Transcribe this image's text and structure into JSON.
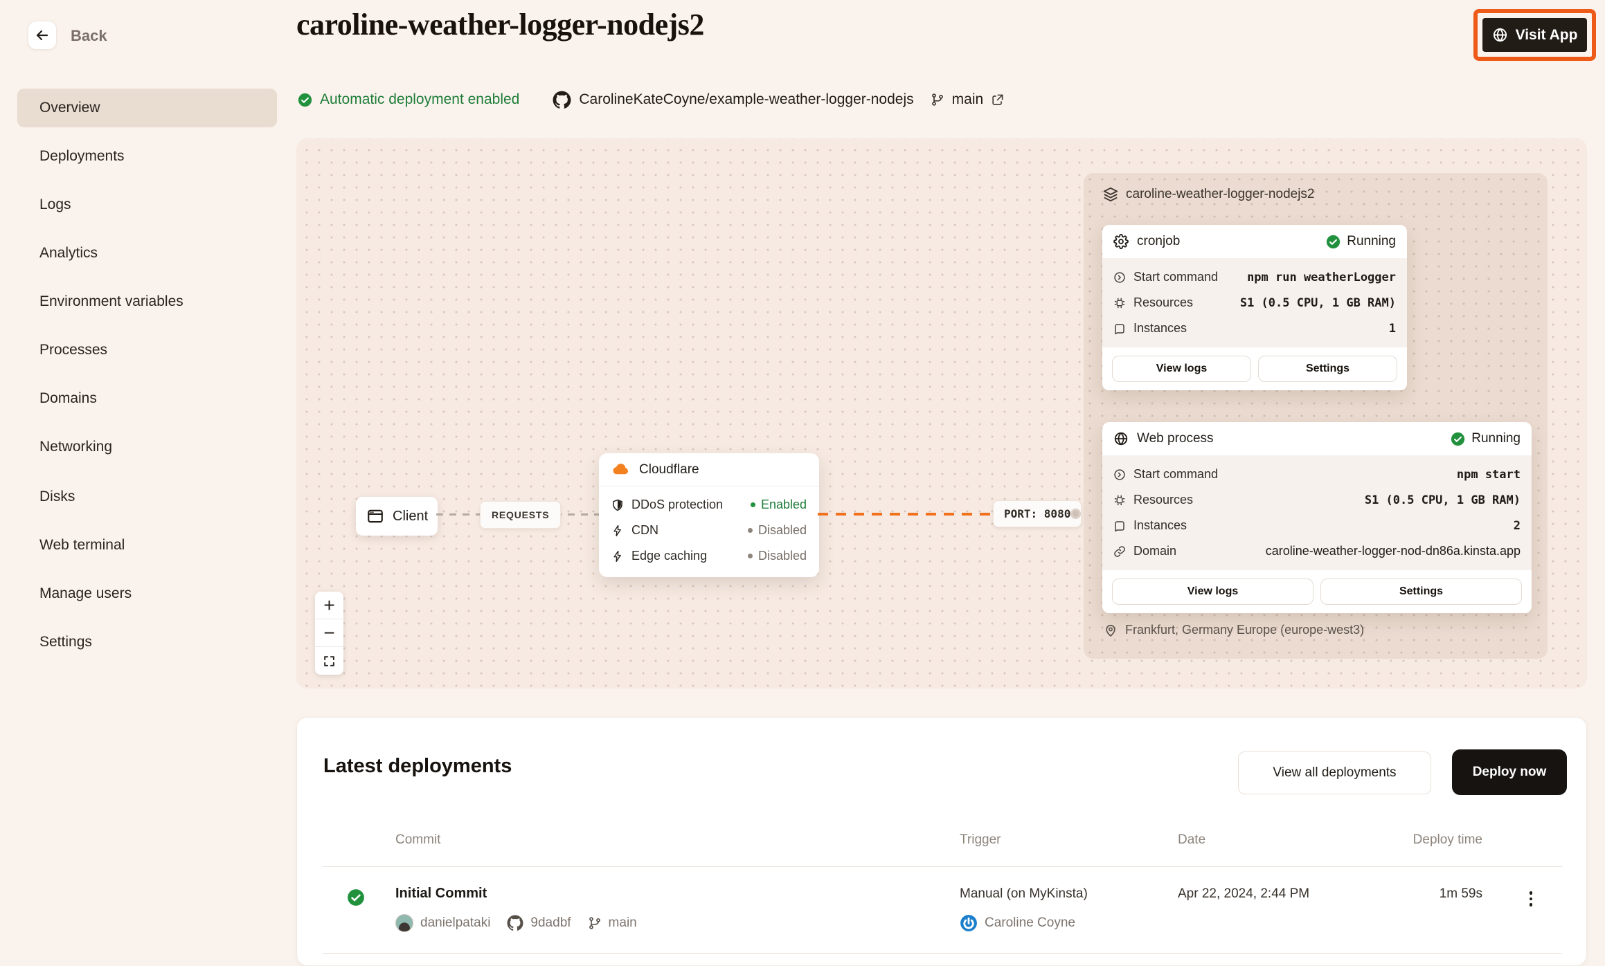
{
  "header": {
    "back_label": "Back",
    "title": "caroline-weather-logger-nodejs2",
    "visit_app_label": "Visit App"
  },
  "sidebar": {
    "items": [
      {
        "label": "Overview",
        "active": true
      },
      {
        "label": "Deployments"
      },
      {
        "label": "Logs"
      },
      {
        "label": "Analytics"
      },
      {
        "label": "Environment variables"
      },
      {
        "label": "Processes"
      },
      {
        "label": "Domains"
      },
      {
        "label": "Networking"
      },
      {
        "label": "Disks"
      },
      {
        "label": "Web terminal"
      },
      {
        "label": "Manage users"
      },
      {
        "label": "Settings"
      }
    ]
  },
  "status_bar": {
    "deployment_status": "Automatic deployment enabled",
    "repo": "CarolineKateCoyne/example-weather-logger-nodejs",
    "branch": "main"
  },
  "diagram": {
    "client_label": "Client",
    "requests_label": "REQUESTS",
    "port_label": "PORT: 8080",
    "cloudflare": {
      "title": "Cloudflare",
      "rows": [
        {
          "icon": "shield-icon",
          "label": "DDoS protection",
          "status": "Enabled"
        },
        {
          "icon": "lightning-icon",
          "label": "CDN",
          "status": "Disabled"
        },
        {
          "icon": "lightning-icon",
          "label": "Edge caching",
          "status": "Disabled"
        }
      ]
    },
    "group": {
      "title": "caroline-weather-logger-nodejs2",
      "location": "Frankfurt, Germany Europe (europe-west3)",
      "cards": [
        {
          "title": "cronjob",
          "status": "Running",
          "rows": [
            {
              "icon": "start-command-icon",
              "label": "Start command",
              "value": "npm run weatherLogger"
            },
            {
              "icon": "chip-icon",
              "label": "Resources",
              "value": "S1 (0.5 CPU, 1 GB RAM)"
            },
            {
              "icon": "instances-icon",
              "label": "Instances",
              "value": "1"
            }
          ],
          "buttons": [
            "View logs",
            "Settings"
          ]
        },
        {
          "title": "Web process",
          "status": "Running",
          "rows": [
            {
              "icon": "start-command-icon",
              "label": "Start command",
              "value": "npm start"
            },
            {
              "icon": "chip-icon",
              "label": "Resources",
              "value": "S1 (0.5 CPU, 1 GB RAM)"
            },
            {
              "icon": "instances-icon",
              "label": "Instances",
              "value": "2"
            },
            {
              "icon": "link-icon",
              "label": "Domain",
              "value": "caroline-weather-logger-nod-dn86a.kinsta.app"
            }
          ],
          "buttons": [
            "View logs",
            "Settings"
          ]
        }
      ]
    },
    "zoom_controls": {
      "zoom_in": "+",
      "zoom_out": "−"
    }
  },
  "deployments": {
    "title": "Latest deployments",
    "view_all_label": "View all deployments",
    "deploy_now_label": "Deploy now",
    "table": {
      "headers": [
        "Commit",
        "Trigger",
        "Date",
        "Deploy time"
      ],
      "rows": [
        {
          "commit_title": "Initial Commit",
          "author": "danielpataki",
          "commit_hash": "9dadbf",
          "branch": "main",
          "trigger": "Manual (on MyKinsta)",
          "trigger_user": "Caroline Coyne",
          "date": "Apr 22, 2024, 2:44 PM",
          "deploy_time": "1m 59s"
        }
      ]
    }
  },
  "colors": {
    "accent_orange": "#ee5a17",
    "cloudflare_orange": "#f48120",
    "success_green": "#1e7c38",
    "kinsta_blue": "#1b7fcb",
    "dark_button": "#171310",
    "page_background": "#faf3ed"
  }
}
